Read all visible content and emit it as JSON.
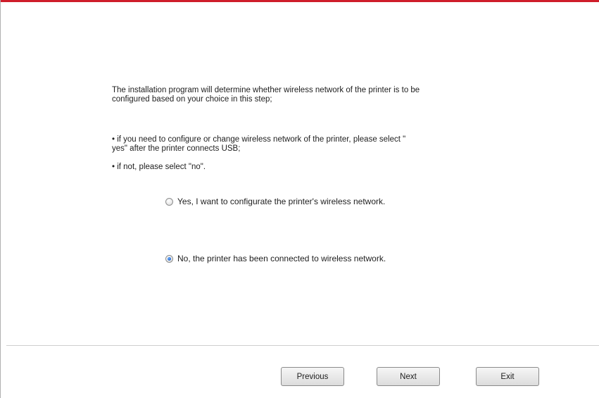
{
  "content": {
    "intro_line1": "The installation program will determine whether wireless network of the printer is to be",
    "intro_line2": "configured based on your choice in this step;",
    "bullet1_line1": "• if you need to configure or change wireless network of the printer, please select \"",
    "bullet1_line2": "yes\" after the printer connects USB;",
    "bullet2": "• if not, please select \"no\"."
  },
  "options": [
    {
      "label": "Yes, I want to configurate the printer's wireless network.",
      "selected": false
    },
    {
      "label": "No, the printer has been connected to wireless network.",
      "selected": true
    }
  ],
  "footer": {
    "previous_label": "Previous",
    "next_label": "Next",
    "exit_label": "Exit"
  },
  "colors": {
    "accent_rule": "#cf1d2a",
    "radio_selected": "#2e6fd4"
  }
}
